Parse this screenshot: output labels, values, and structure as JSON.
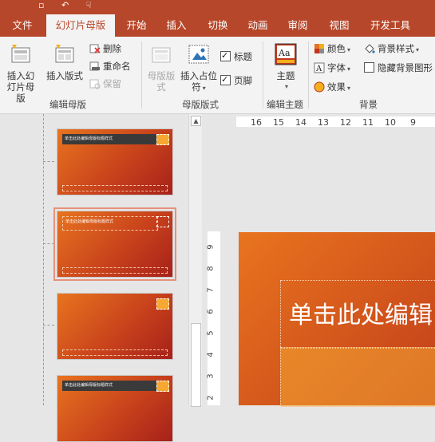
{
  "tabs": [
    {
      "label": "文件"
    },
    {
      "label": "幻灯片母版"
    },
    {
      "label": "开始"
    },
    {
      "label": "插入"
    },
    {
      "label": "切换"
    },
    {
      "label": "动画"
    },
    {
      "label": "审阅"
    },
    {
      "label": "视图"
    },
    {
      "label": "开发工具"
    }
  ],
  "ribbon": {
    "insert_slide_master": "插入幻灯片母版",
    "insert_layout": "插入版式",
    "delete": "删除",
    "rename": "重命名",
    "preserve": "保留",
    "group_edit_master": "编辑母版",
    "master_layout": "母版版式",
    "insert_placeholder": "插入占位符",
    "title_checkbox": "标题",
    "footer_checkbox": "页脚",
    "group_master_layout": "母版版式",
    "theme": "主题",
    "group_edit_theme": "编辑主题",
    "colors": "颜色",
    "fonts": "字体",
    "effects": "效果",
    "background_styles": "背景样式",
    "hide_background": "隐藏背景图形",
    "group_background": "背景"
  },
  "checkboxes": {
    "title_checked": true,
    "footer_checked": true,
    "hide_background_checked": false
  },
  "thumbnails": [
    {
      "caption": "单击此处编辑母版标题样式"
    },
    {
      "caption": "单击此处编辑母版标题样式"
    },
    {
      "caption": ""
    },
    {
      "caption": "单击此处编辑母版标题样式"
    }
  ],
  "ruler": {
    "horizontal": [
      "16",
      "15",
      "14",
      "13",
      "12",
      "11",
      "10",
      "9"
    ],
    "vertical": [
      "9",
      "8",
      "7",
      "6",
      "5",
      "4",
      "3",
      "2"
    ]
  },
  "slide": {
    "title_placeholder": "单击此处编辑"
  },
  "colors": {
    "accent": "#b7472a",
    "slide_orange": "#e8741f"
  }
}
